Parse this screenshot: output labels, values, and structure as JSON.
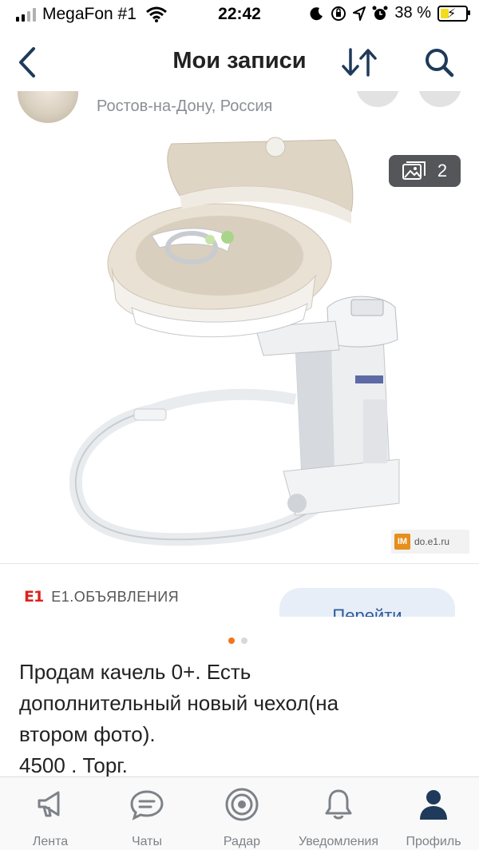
{
  "status_bar": {
    "carrier": "MegaFon #1",
    "time": "22:42",
    "battery_percent": "38 %",
    "battery_level": 0.38,
    "battery_fill_color": "#f3dc1a",
    "icons": [
      "signal-icon",
      "wifi-icon",
      "moon-icon",
      "orientation-lock-icon",
      "location-icon",
      "alarm-icon",
      "battery-icon"
    ]
  },
  "navbar": {
    "title": "Мои записи",
    "icons": [
      "back-icon",
      "sort-icon",
      "search-icon"
    ]
  },
  "post": {
    "location": "Ростов-на-Дону, Россия",
    "photo_counter": "2",
    "watermark": "do.e1.ru",
    "watermark_logo": "IM",
    "source_logo": "E1",
    "source_name": "E1.ОБЪЯВЛЕНИЯ",
    "go_button": "Перейти",
    "carousel": {
      "count": 2,
      "active": 0
    },
    "text_lines": [
      "Продам качель 0+. Есть",
      "дополнительный новый чехол(на",
      "втором фото).",
      "4500 . Торг."
    ]
  },
  "colors": {
    "accent": "#f2741b",
    "e1_red": "#e02020",
    "link_blue": "#2c5aa0"
  },
  "tabbar": {
    "items": [
      {
        "label": "Лента",
        "icon": "megaphone-icon"
      },
      {
        "label": "Чаты",
        "icon": "chat-icon"
      },
      {
        "label": "Радар",
        "icon": "radar-icon"
      },
      {
        "label": "Уведомления",
        "icon": "bell-icon"
      },
      {
        "label": "Профиль",
        "icon": "profile-icon"
      }
    ]
  }
}
